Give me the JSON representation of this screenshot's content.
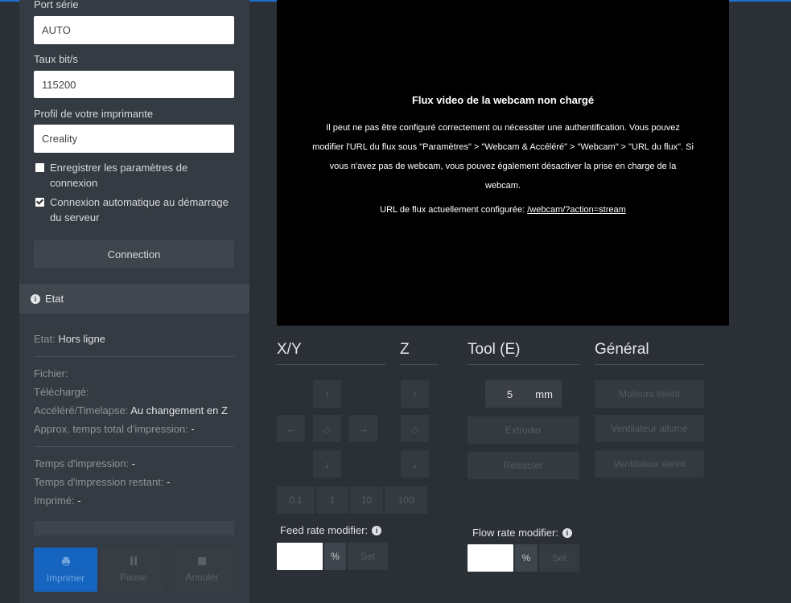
{
  "connection": {
    "port_label": "Port série",
    "port_value": "AUTO",
    "baud_label": "Taux bit/s",
    "baud_value": "115200",
    "profile_label": "Profil de votre imprimante",
    "profile_value": "Creality",
    "save_settings_label": "Enregistrer les paramètres de connexion",
    "save_settings_checked": false,
    "autoconnect_label": "Connexion automatique au démarrage du serveur",
    "autoconnect_checked": true,
    "connect_button": "Connection"
  },
  "state": {
    "section_title": "Etat",
    "status_label": "Etat:",
    "status_value": "Hors ligne",
    "file_label": "Fichier:",
    "uploaded_label": "Téléchargé:",
    "timelapse_label": "Accéléré/Timelapse:",
    "timelapse_value": "Au changement en Z",
    "approx_label": "Approx. temps total d'impression:",
    "approx_value": "-",
    "print_time_label": "Temps d'impression:",
    "print_time_value": "-",
    "remaining_label": "Temps d'impression restant:",
    "remaining_value": "-",
    "printed_label": "Imprimé:",
    "printed_value": "-",
    "progress_percent": 0
  },
  "actions": {
    "print": "Imprimer",
    "pause": "Pause",
    "cancel": "Annuler"
  },
  "webcam": {
    "title": "Flux video de la webcam non chargé",
    "message": "Il peut ne pas être configuré correctement ou nécessiter une authentification. Vous pouvez modifier l'URL du flux sous \"Paramètres\" > \"Webcam & Accéléré\" > \"Webcam\" > \"URL du flux\". Si vous n'avez pas de webcam, vous pouvez également désactiver la prise en charge de la webcam.",
    "url_label": "URL de flux actuellement configurée:",
    "url_value": "/webcam/?action=stream"
  },
  "controls": {
    "xy_title": "X/Y",
    "z_title": "Z",
    "tool_title": "Tool (E)",
    "general_title": "Général",
    "step_sizes": [
      "0.1",
      "1",
      "10",
      "100"
    ],
    "extrude_amount": "5",
    "extrude_unit": "mm",
    "extrude_button": "Extruder",
    "retract_button": "Rétracter",
    "motors_off": "Moteurs éteint",
    "fan_on": "Ventilateur allumé",
    "fan_off": "Ventilateur éteint",
    "feed_rate_label": "Feed rate modifier:",
    "flow_rate_label": "Flow rate modifier:",
    "percent_sign": "%",
    "set_button": "Set",
    "info_icon_glyph": "i"
  },
  "icons": {
    "arrow_up": "↑",
    "arrow_down": "↓",
    "arrow_left": "←",
    "arrow_right": "→",
    "home": "⌂"
  },
  "colors": {
    "accent": "#1e6fd0",
    "print_button": "#1565c0"
  }
}
